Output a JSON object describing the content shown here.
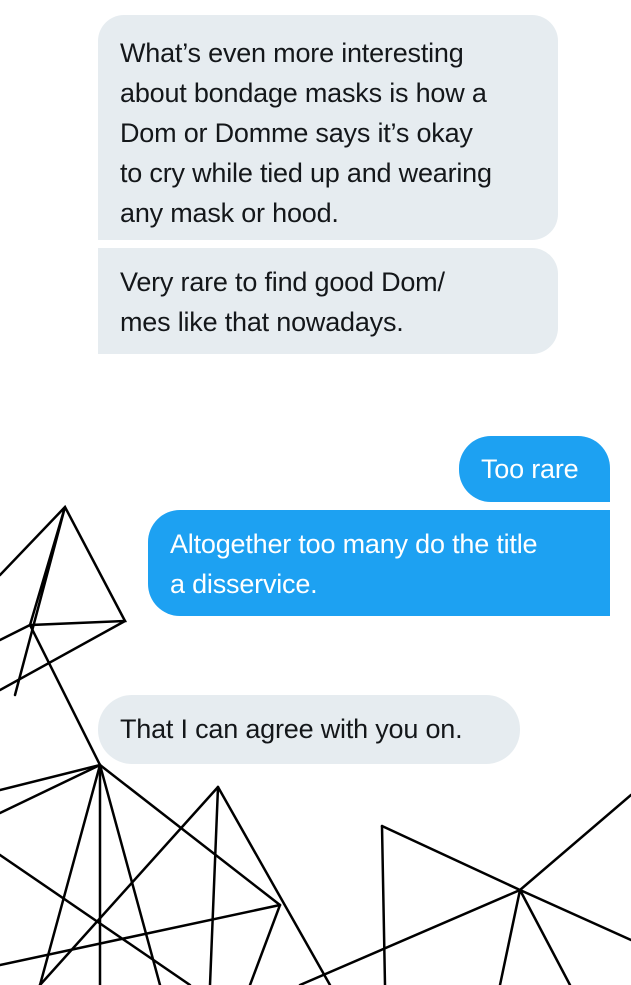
{
  "messages": [
    {
      "sender": "them",
      "text": "What’s even more interesting\nabout bondage masks is how a\nDom or Domme says it’s okay\nto cry while tied up and wearing\nany mask or hood."
    },
    {
      "sender": "them",
      "text": "Very rare to find good Dom/\nmes like that nowadays."
    },
    {
      "sender": "me",
      "text": "Too rare"
    },
    {
      "sender": "me",
      "text": "Altogether too many do the title\na disservice."
    },
    {
      "sender": "them",
      "text": "That I can agree with you on."
    }
  ],
  "colors": {
    "received_bubble": "#e6ecf0",
    "received_text": "#14171a",
    "sent_bubble": "#1da1f2",
    "sent_text": "#ffffff",
    "background": "#ffffff",
    "decoration_lines": "#000000"
  },
  "decoration": {
    "icon": "geometric-triangle-lines"
  }
}
